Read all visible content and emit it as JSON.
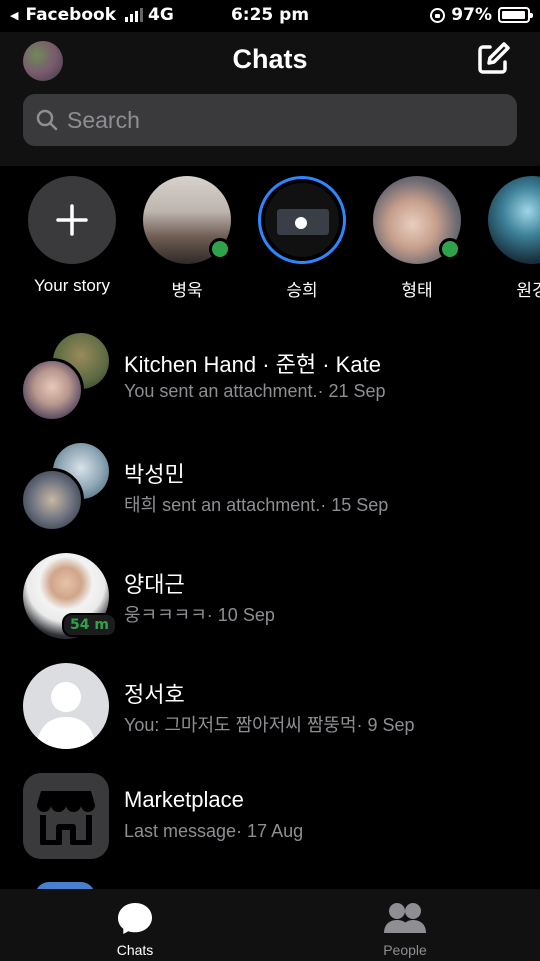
{
  "status_bar": {
    "back_app": "Facebook",
    "network": "4G",
    "time": "6:25 pm",
    "battery_percent": "97%",
    "battery_level": 0.97
  },
  "header": {
    "title": "Chats",
    "search_placeholder": "Search"
  },
  "stories": [
    {
      "label": "Your story",
      "type": "add"
    },
    {
      "label": "병욱",
      "online": true
    },
    {
      "label": "승희",
      "active_story": true
    },
    {
      "label": "형태",
      "online": true
    },
    {
      "label": "원경"
    }
  ],
  "chats": [
    {
      "name": "Kitchen Hand · 준현 · Kate",
      "preview": "You sent an attachment.· 21 Sep"
    },
    {
      "name": "박성민",
      "preview": "태희 sent an attachment.· 15 Sep"
    },
    {
      "name": "양대근",
      "preview": "웅ㅋㅋㅋㅋ· 10 Sep",
      "active_badge": "54 m"
    },
    {
      "name": "정서호",
      "preview": "You: 그마저도 짬아저씨 짬뚱먹· 9 Sep"
    },
    {
      "name": "Marketplace",
      "preview": "Last message· 17 Aug"
    }
  ],
  "tabs": [
    {
      "label": "Chats",
      "icon": "chat-bubble-icon",
      "selected": true
    },
    {
      "label": "People",
      "icon": "people-icon",
      "selected": false
    }
  ],
  "colors": {
    "accent": "#2d88ff",
    "online": "#31a24c",
    "secondary_text": "#8e8e93",
    "search_bg": "#3a3a3c"
  }
}
